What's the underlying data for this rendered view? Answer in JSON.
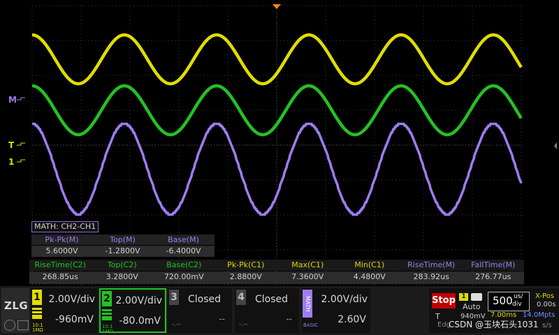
{
  "channels": {
    "ch1": {
      "number": "1",
      "scale": "2.00V/div",
      "offset": "-960mV",
      "probe": "10:1",
      "impedance": "1MΩ",
      "color": "#e0dd00"
    },
    "ch2": {
      "number": "2",
      "scale": "2.00V/div",
      "offset": "-80.0mV",
      "probe": "10:1",
      "impedance": "1MΩ",
      "color": "#22c222"
    },
    "ch3": {
      "number": "3",
      "status": "Closed",
      "offset": "--",
      "sub": "-.--",
      "color": "#bdbdbd"
    },
    "ch4": {
      "number": "4",
      "status": "Closed",
      "offset": "--",
      "sub": "-.--",
      "color": "#bdbdbd"
    },
    "math": {
      "label": "MATH",
      "scale": "2.00V/div",
      "offset": "2.60V",
      "sub": "BASIC",
      "color": "#9f7cf2"
    }
  },
  "markers": {
    "math_marker": "M",
    "trigger_marker": "T",
    "ch1_marker": "1"
  },
  "math_panel": {
    "title": "MATH: CH2-CH1",
    "headers": [
      "Pk-Pk(M)",
      "Top(M)",
      "Base(M)"
    ],
    "values": [
      "5.6000V",
      "-1.2800V",
      "-6.4000V"
    ]
  },
  "measurements": {
    "headers": [
      "RiseTime(C2)",
      "Top(C2)",
      "Base(C2)",
      "Pk-Pk(C1)",
      "Max(C1)",
      "Min(C1)",
      "RiseTime(M)",
      "FallTime(M)"
    ],
    "values": [
      "268.85us",
      "3.2800V",
      "720.00mV",
      "2.8800V",
      "7.3600V",
      "4.4800V",
      "283.92us",
      "276.77us"
    ],
    "colors": [
      "#22c222",
      "#22c222",
      "#22c222",
      "#d8d500",
      "#d8d500",
      "#d8d500",
      "#9f7cf2",
      "#9f7cf2"
    ]
  },
  "run_control": {
    "state": "Stop",
    "color": "#c20000"
  },
  "trigger": {
    "source": "1",
    "mode": "Auto",
    "label": "T",
    "level": "940mV",
    "edge_label": "Edg"
  },
  "timebase": {
    "scale": "500",
    "unit_top": "us/",
    "unit_bottom": "div",
    "sample_time": "7.00ms",
    "sample_rate": "14.0Mpts",
    "sample_rate2": "s/s"
  },
  "xpos": {
    "label": "X-Pos",
    "value": "0.00s"
  },
  "watermark": "CSDN @玉块石头1031"
}
